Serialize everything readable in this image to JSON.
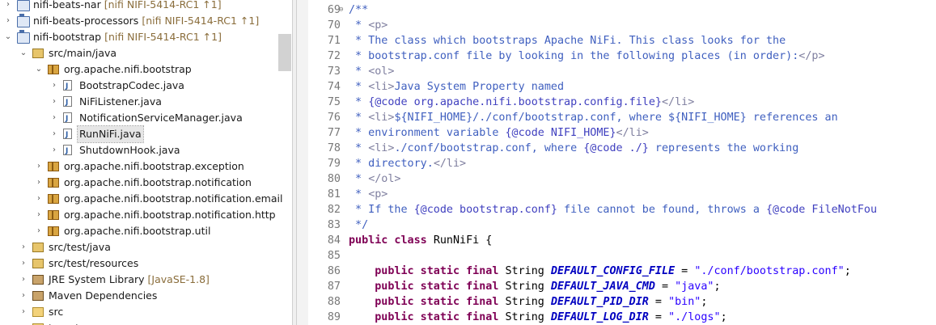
{
  "explorer": {
    "rows": [
      {
        "name": "project-nifi-beats-nar",
        "indent": 0,
        "twisty": "›",
        "icon": "project",
        "label": "nifi-beats-nar",
        "decoration": "[nifi NIFI-5414-RC1 ↑1]"
      },
      {
        "name": "project-nifi-beats-processors",
        "indent": 0,
        "twisty": "›",
        "icon": "project",
        "label": "nifi-beats-processors",
        "decoration": "[nifi NIFI-5414-RC1 ↑1]"
      },
      {
        "name": "project-nifi-bootstrap",
        "indent": 0,
        "twisty": "⌄",
        "icon": "project",
        "label": "nifi-bootstrap",
        "decoration": "[nifi NIFI-5414-RC1 ↑1]"
      },
      {
        "name": "source-folder-src-main-java",
        "indent": 1,
        "twisty": "⌄",
        "icon": "source",
        "label": "src/main/java",
        "decoration": ""
      },
      {
        "name": "package-org-apache-nifi-bootstrap",
        "indent": 2,
        "twisty": "⌄",
        "icon": "package",
        "label": "org.apache.nifi.bootstrap",
        "decoration": ""
      },
      {
        "name": "file-bootstrapcodec",
        "indent": 3,
        "twisty": "›",
        "icon": "java",
        "label": "BootstrapCodec.java",
        "decoration": ""
      },
      {
        "name": "file-nifilistener",
        "indent": 3,
        "twisty": "›",
        "icon": "java",
        "label": "NiFiListener.java",
        "decoration": ""
      },
      {
        "name": "file-notificationservicemanager",
        "indent": 3,
        "twisty": "›",
        "icon": "java",
        "label": "NotificationServiceManager.java",
        "decoration": ""
      },
      {
        "name": "file-runnifi",
        "indent": 3,
        "twisty": "›",
        "icon": "java",
        "label": "RunNiFi.java",
        "decoration": "",
        "selected": true
      },
      {
        "name": "file-shutdownhook",
        "indent": 3,
        "twisty": "›",
        "icon": "java",
        "label": "ShutdownHook.java",
        "decoration": ""
      },
      {
        "name": "package-bootstrap-exception",
        "indent": 2,
        "twisty": "›",
        "icon": "package",
        "label": "org.apache.nifi.bootstrap.exception",
        "decoration": ""
      },
      {
        "name": "package-bootstrap-notification",
        "indent": 2,
        "twisty": "›",
        "icon": "package",
        "label": "org.apache.nifi.bootstrap.notification",
        "decoration": ""
      },
      {
        "name": "package-bootstrap-notification-email",
        "indent": 2,
        "twisty": "›",
        "icon": "package",
        "label": "org.apache.nifi.bootstrap.notification.email",
        "decoration": ""
      },
      {
        "name": "package-bootstrap-notification-http",
        "indent": 2,
        "twisty": "›",
        "icon": "package",
        "label": "org.apache.nifi.bootstrap.notification.http",
        "decoration": ""
      },
      {
        "name": "package-bootstrap-util",
        "indent": 2,
        "twisty": "›",
        "icon": "package",
        "label": "org.apache.nifi.bootstrap.util",
        "decoration": ""
      },
      {
        "name": "source-folder-src-test-java",
        "indent": 1,
        "twisty": "›",
        "icon": "source",
        "label": "src/test/java",
        "decoration": ""
      },
      {
        "name": "source-folder-src-test-resources",
        "indent": 1,
        "twisty": "›",
        "icon": "source",
        "label": "src/test/resources",
        "decoration": ""
      },
      {
        "name": "library-jre-system",
        "indent": 1,
        "twisty": "›",
        "icon": "library",
        "label": "JRE System Library",
        "decoration": "[JavaSE-1.8]"
      },
      {
        "name": "library-maven-dependencies",
        "indent": 1,
        "twisty": "›",
        "icon": "library",
        "label": "Maven Dependencies",
        "decoration": ""
      },
      {
        "name": "folder-src",
        "indent": 1,
        "twisty": "›",
        "icon": "folder",
        "label": "src",
        "decoration": ""
      },
      {
        "name": "folder-target",
        "indent": 1,
        "twisty": "›",
        "icon": "folder",
        "label": "target",
        "decoration": ""
      }
    ]
  },
  "editor": {
    "lines": [
      {
        "n": "69",
        "fold": "⊖",
        "tokens": [
          [
            "doc",
            "/**"
          ]
        ]
      },
      {
        "n": "70",
        "tokens": [
          [
            "doc",
            " * "
          ],
          [
            "tag",
            "<p>"
          ]
        ]
      },
      {
        "n": "71",
        "tokens": [
          [
            "doc",
            " * The class which bootstraps Apache NiFi. This class looks for the"
          ]
        ]
      },
      {
        "n": "72",
        "tokens": [
          [
            "doc",
            " * bootstrap.conf file by looking in the following places (in order):"
          ],
          [
            "tag",
            "</p>"
          ]
        ]
      },
      {
        "n": "73",
        "tokens": [
          [
            "doc",
            " * "
          ],
          [
            "tag",
            "<ol>"
          ]
        ]
      },
      {
        "n": "74",
        "tokens": [
          [
            "doc",
            " * "
          ],
          [
            "tag",
            "<li>"
          ],
          [
            "doc",
            "Java System Property named"
          ]
        ]
      },
      {
        "n": "75",
        "tokens": [
          [
            "doc",
            " * "
          ],
          [
            "code",
            "{@code org.apache.nifi.bootstrap.config.file}"
          ],
          [
            "tag",
            "</li>"
          ]
        ]
      },
      {
        "n": "76",
        "tokens": [
          [
            "doc",
            " * "
          ],
          [
            "tag",
            "<li>"
          ],
          [
            "doc",
            "${NIFI_HOME}/./conf/bootstrap.conf, where ${NIFI_HOME} references an"
          ]
        ]
      },
      {
        "n": "77",
        "tokens": [
          [
            "doc",
            " * environment variable "
          ],
          [
            "code",
            "{@code NIFI_HOME}"
          ],
          [
            "tag",
            "</li>"
          ]
        ]
      },
      {
        "n": "78",
        "tokens": [
          [
            "doc",
            " * "
          ],
          [
            "tag",
            "<li>"
          ],
          [
            "doc",
            "./conf/bootstrap.conf, where "
          ],
          [
            "code",
            "{@code ./}"
          ],
          [
            "doc",
            " represents the working"
          ]
        ]
      },
      {
        "n": "79",
        "tokens": [
          [
            "doc",
            " * directory."
          ],
          [
            "tag",
            "</li>"
          ]
        ]
      },
      {
        "n": "80",
        "tokens": [
          [
            "doc",
            " * "
          ],
          [
            "tag",
            "</ol>"
          ]
        ]
      },
      {
        "n": "81",
        "tokens": [
          [
            "doc",
            " * "
          ],
          [
            "tag",
            "<p>"
          ]
        ]
      },
      {
        "n": "82",
        "tokens": [
          [
            "doc",
            " * If the "
          ],
          [
            "code",
            "{@code bootstrap.conf}"
          ],
          [
            "doc",
            " file cannot be found, throws a "
          ],
          [
            "code",
            "{@code FileNotFou"
          ]
        ]
      },
      {
        "n": "83",
        "tokens": [
          [
            "doc",
            " */"
          ]
        ]
      },
      {
        "n": "84",
        "tokens": [
          [
            "kw",
            "public class "
          ],
          [
            "plain",
            "RunNiFi {"
          ]
        ]
      },
      {
        "n": "85",
        "tokens": []
      },
      {
        "n": "86",
        "tokens": [
          [
            "plain",
            "    "
          ],
          [
            "kw",
            "public static final "
          ],
          [
            "plain",
            "String "
          ],
          [
            "const",
            "DEFAULT_CONFIG_FILE"
          ],
          [
            "plain",
            " = "
          ],
          [
            "str",
            "\"./conf/bootstrap.conf\""
          ],
          [
            "plain",
            ";"
          ]
        ]
      },
      {
        "n": "87",
        "tokens": [
          [
            "plain",
            "    "
          ],
          [
            "kw",
            "public static final "
          ],
          [
            "plain",
            "String "
          ],
          [
            "const",
            "DEFAULT_JAVA_CMD"
          ],
          [
            "plain",
            " = "
          ],
          [
            "str",
            "\"java\""
          ],
          [
            "plain",
            ";"
          ]
        ]
      },
      {
        "n": "88",
        "tokens": [
          [
            "plain",
            "    "
          ],
          [
            "kw",
            "public static final "
          ],
          [
            "plain",
            "String "
          ],
          [
            "const",
            "DEFAULT_PID_DIR"
          ],
          [
            "plain",
            " = "
          ],
          [
            "str",
            "\"bin\""
          ],
          [
            "plain",
            ";"
          ]
        ]
      },
      {
        "n": "89",
        "tokens": [
          [
            "plain",
            "    "
          ],
          [
            "kw",
            "public static final "
          ],
          [
            "plain",
            "String "
          ],
          [
            "const",
            "DEFAULT_LOG_DIR"
          ],
          [
            "plain",
            " = "
          ],
          [
            "str",
            "\"./logs\""
          ],
          [
            "plain",
            ";"
          ]
        ]
      }
    ]
  }
}
